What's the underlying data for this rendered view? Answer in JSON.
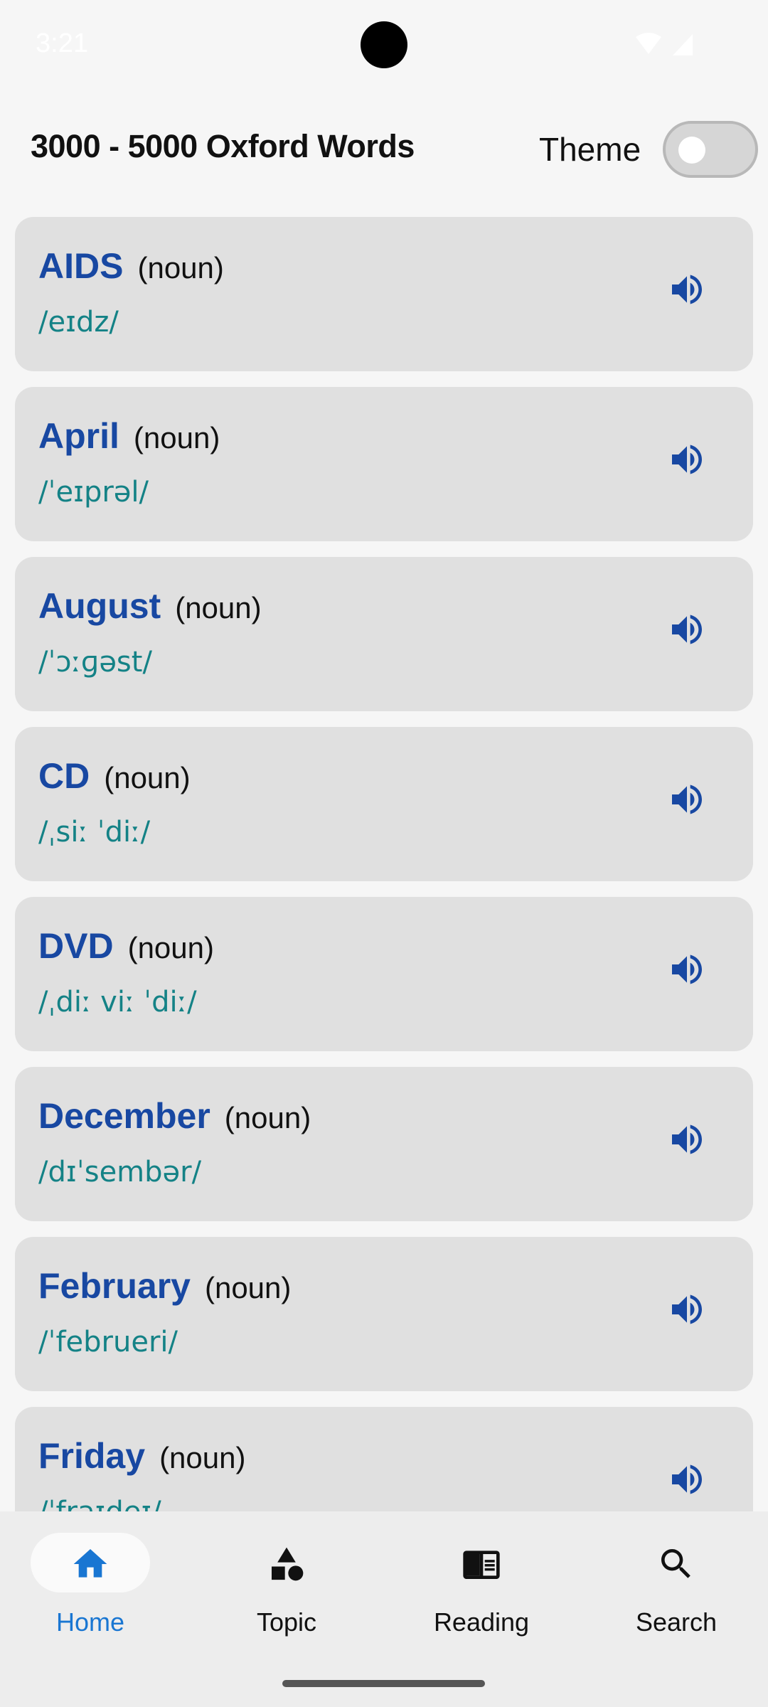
{
  "status_bar": {
    "time": "3:21"
  },
  "header": {
    "title": "3000 - 5000 Oxford Words",
    "theme_label": "Theme",
    "theme_on": false
  },
  "words": [
    {
      "word": "AIDS",
      "pos": "(noun)",
      "ipa": "/eɪdz/"
    },
    {
      "word": "April",
      "pos": "(noun)",
      "ipa": "/ˈeɪprəl/"
    },
    {
      "word": "August",
      "pos": "(noun)",
      "ipa": "/ˈɔːɡəst/"
    },
    {
      "word": "CD",
      "pos": "(noun)",
      "ipa": "/ˌsiː ˈdiː/"
    },
    {
      "word": "DVD",
      "pos": "(noun)",
      "ipa": "/ˌdiː viː ˈdiː/"
    },
    {
      "word": "December",
      "pos": "(noun)",
      "ipa": "/dɪˈsembər/"
    },
    {
      "word": "February",
      "pos": "(noun)",
      "ipa": "/ˈfebrueri/"
    },
    {
      "word": "Friday",
      "pos": "(noun)",
      "ipa": "/ˈfraɪdeɪ/"
    }
  ],
  "nav": [
    {
      "label": "Home",
      "icon": "home-icon",
      "active": true
    },
    {
      "label": "Topic",
      "icon": "shapes-icon",
      "active": false
    },
    {
      "label": "Reading",
      "icon": "reading-icon",
      "active": false
    },
    {
      "label": "Search",
      "icon": "search-icon",
      "active": false
    }
  ],
  "colors": {
    "word": "#1848a2",
    "ipa": "#148286",
    "card": "#e0e0e0",
    "nav_active": "#1976d2",
    "speaker": "#1848a2"
  }
}
